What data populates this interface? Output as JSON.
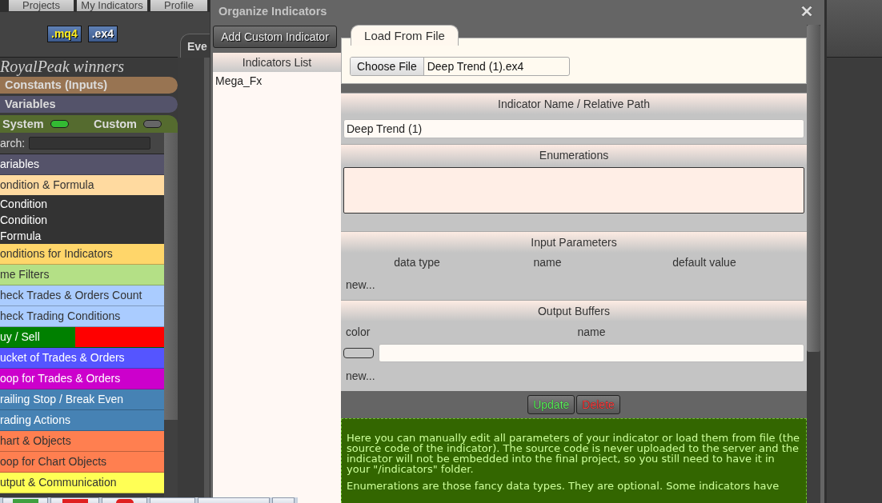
{
  "top_nav": [
    {
      "label": "Projects"
    },
    {
      "label": "My Indicators"
    },
    {
      "label": "Profile"
    }
  ],
  "file_types": [
    {
      "label": ".mq4",
      "selected": true
    },
    {
      "label": ".ex4",
      "selected": false
    }
  ],
  "editor_tab": {
    "label": "Eve"
  },
  "sidebar": {
    "project_name": "RoyalPeak winners",
    "sections": [
      {
        "label": "Constants (Inputs)",
        "color": "#987452"
      },
      {
        "label": "Variables",
        "color": "#54536a"
      }
    ],
    "toggles": [
      {
        "label": "System",
        "on": true
      },
      {
        "label": "Custom",
        "on": false
      }
    ],
    "search": {
      "label": "arch:"
    },
    "categories": [
      {
        "label": "ariables",
        "color": "#55536a"
      },
      {
        "label": "ondition & Formula",
        "color": "#ffdaa0",
        "expanded": true,
        "children": [
          {
            "label": "Condition"
          },
          {
            "label": "Condition"
          },
          {
            "label": "Formula"
          }
        ]
      },
      {
        "label": "onditions for Indicators",
        "color": "#ffd66a"
      },
      {
        "label": "me Filters",
        "color": "#b4e086"
      },
      {
        "label": "heck Trades & Orders Count",
        "color": "#aaccff"
      },
      {
        "label": "heck Trading Conditions",
        "color": "#aaccff"
      },
      {
        "label": "uy / Sell",
        "color": "#008000",
        "segments": [
          {
            "color": "#ff0000"
          }
        ]
      },
      {
        "label": "ucket of Trades & Orders",
        "color": "#5555ff"
      },
      {
        "label": "oop for Trades & Orders",
        "color": "#cc00cc"
      },
      {
        "label": "railing Stop / Break Even",
        "color": "#4682b4"
      },
      {
        "label": "rading Actions",
        "color": "#4682b4"
      },
      {
        "label": "hart & Objects",
        "color": "#ff7f50"
      },
      {
        "label": "oop for Chart Objects",
        "color": "#ff7f50"
      },
      {
        "label": "utput & Communication",
        "color": "#ffff55"
      }
    ]
  },
  "dialog": {
    "title": "Organize Indicators",
    "add_button": "Add Custom Indicator",
    "indicators_list": {
      "header": "Indicators List",
      "items": [
        {
          "label": "Mega_Fx",
          "selected": false
        }
      ]
    },
    "tabs": [
      {
        "label": "Load From File",
        "selected": true
      }
    ],
    "file_input": {
      "button": "Choose File",
      "value": "Deep Trend (1).ex4"
    },
    "name_field": {
      "header": "Indicator Name / Relative Path",
      "value": "Deep Trend (1)"
    },
    "enumerations": {
      "header": "Enumerations"
    },
    "input_parameters": {
      "header": "Input Parameters",
      "columns": [
        "data type",
        "name",
        "default value"
      ],
      "new_link": "new..."
    },
    "output_buffers": {
      "header": "Output Buffers",
      "columns": [
        "color",
        "name"
      ],
      "rows": [
        {
          "kind": "buffer"
        }
      ],
      "new_link": "new..."
    },
    "actions": [
      {
        "label": "Update",
        "kind": "update"
      },
      {
        "label": "Delete",
        "kind": "delete"
      }
    ],
    "help": [
      "Here you can manually edit all parameters of your indicator or load them from file (the source code of the indicator). The source code is never uploaded to the server and the indicator will not be embedded into the final project, so you still need to have it in your \"/indicators\" folder.",
      "Enumerations are those fancy data types. They are optional. Some indicators have"
    ]
  }
}
